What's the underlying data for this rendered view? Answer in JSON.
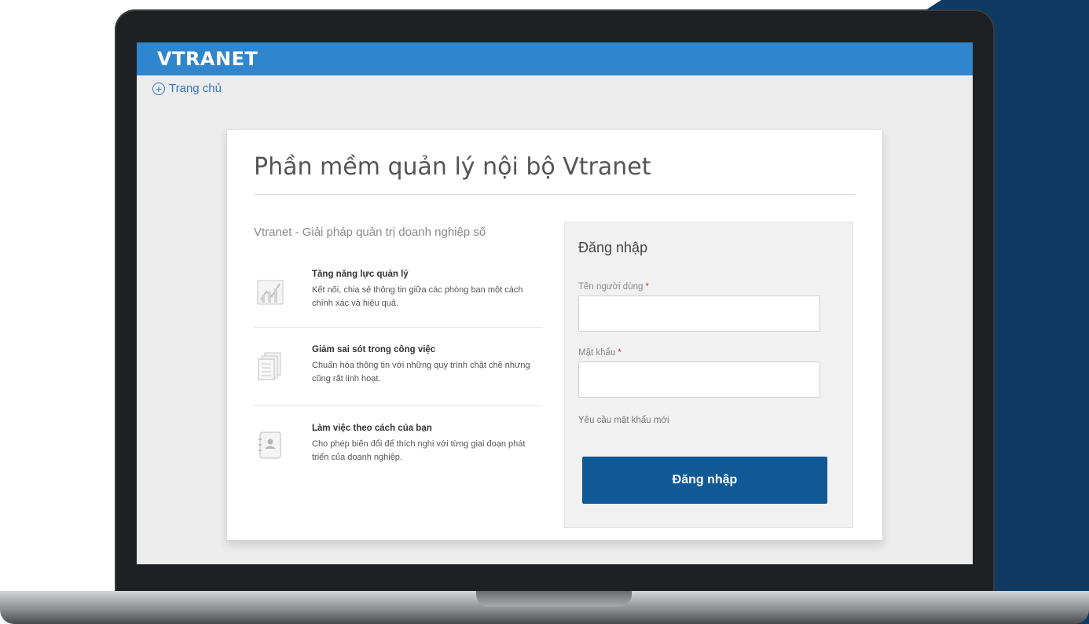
{
  "brand": {
    "logo": "VTRANET"
  },
  "nav": {
    "home_label": "Trang chủ",
    "home_icon": "plus-circle-icon"
  },
  "main": {
    "title": "Phần mềm quản lý nội bộ Vtranet",
    "tagline": "Vtranet - Giải pháp quản trị doanh nghiệp số",
    "features": [
      {
        "icon": "chart-icon",
        "title": "Tăng năng lực quản lý",
        "description": "Kết nối, chia sẻ thông tin giữa các phòng ban một cách chính xác và hiệu quả."
      },
      {
        "icon": "documents-icon",
        "title": "Giảm sai sót trong công việc",
        "description": "Chuẩn hóa thông tin với những quy trình chặt chẽ nhưng cũng rất linh hoạt."
      },
      {
        "icon": "contact-card-icon",
        "title": "Làm việc theo cách của bạn",
        "description": "Cho phép biến đổi để thích nghi với từng giai đoạn phát triển của doanh nghiệp."
      }
    ]
  },
  "login": {
    "title": "Đăng nhập",
    "username_label": "Tên người dùng",
    "username_value": "",
    "password_label": "Mật khẩu",
    "password_value": "",
    "required_mark": "*",
    "reset_link": "Yêu cầu mật khẩu mới",
    "submit_label": "Đăng nhập"
  },
  "colors": {
    "topbar": "#2f86cf",
    "button": "#0f5a96",
    "link": "#2f77c2",
    "required": "#c0392b",
    "backdrop_navy": "#0e3a63"
  }
}
